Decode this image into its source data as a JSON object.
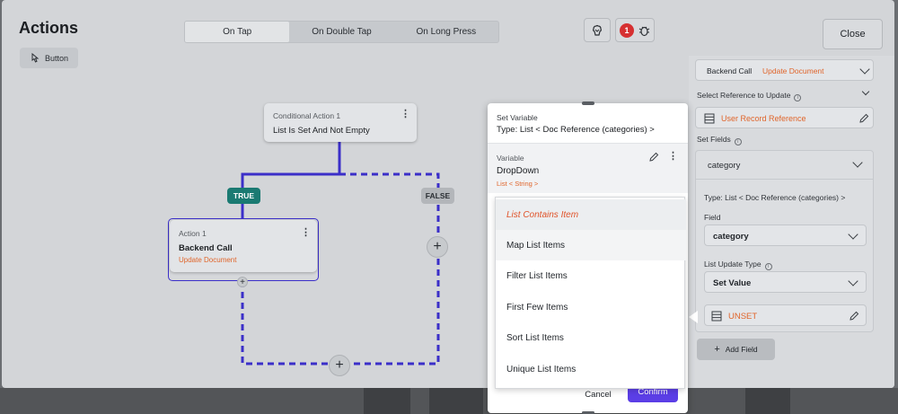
{
  "header": {
    "title": "Actions"
  },
  "tabs": [
    {
      "label": "On Tap",
      "active": true
    },
    {
      "label": "On Double Tap",
      "active": false
    },
    {
      "label": "On Long Press",
      "active": false
    }
  ],
  "toolbar": {
    "issues_count": "1",
    "close_label": "Close",
    "button_chip_label": "Button"
  },
  "flow": {
    "condition_node": {
      "subtitle": "Conditional Action 1",
      "title": "List Is Set And Not Empty"
    },
    "true_label": "TRUE",
    "false_label": "FALSE",
    "action_node": {
      "subtitle": "Action 1",
      "title": "Backend Call",
      "detail": "Update Document"
    }
  },
  "right_panel": {
    "backend_call_label": "Backend Call",
    "backend_call_value": "Update Document",
    "select_reference_label": "Select Reference to Update",
    "reference_value": "User Record Reference",
    "set_fields_label": "Set Fields",
    "field_group_value": "category",
    "type_text": "Type: List < Doc Reference (categories) >",
    "field_label": "Field",
    "field_value": "category",
    "list_update_type_label": "List Update Type",
    "list_update_type_value": "Set Value",
    "unset_value": "UNSET",
    "add_field_label": "Add Field"
  },
  "set_variable": {
    "header": "Set Variable",
    "type_text": "Type: List < Doc Reference (categories) >",
    "variable_label": "Variable",
    "variable_name": "DropDown",
    "variable_type": "List < String >",
    "cancel_label": "Cancel",
    "confirm_label": "Confirm"
  },
  "dropdown": {
    "items": [
      {
        "label": "List Contains Item",
        "state": "selected"
      },
      {
        "label": "Map List Items",
        "state": "hover"
      },
      {
        "label": "Filter List Items",
        "state": "normal"
      },
      {
        "label": "First Few Items",
        "state": "normal"
      },
      {
        "label": "Sort List Items",
        "state": "normal"
      },
      {
        "label": "Unique List Items",
        "state": "normal"
      }
    ]
  },
  "colors": {
    "flow_line": "#3b2fc9",
    "true_pill": "#1a7a72",
    "false_pill": "#b3b6ba",
    "accent_orange": "#e0652b",
    "confirm_button": "#5b3ee6",
    "badge_red": "#d63031"
  }
}
